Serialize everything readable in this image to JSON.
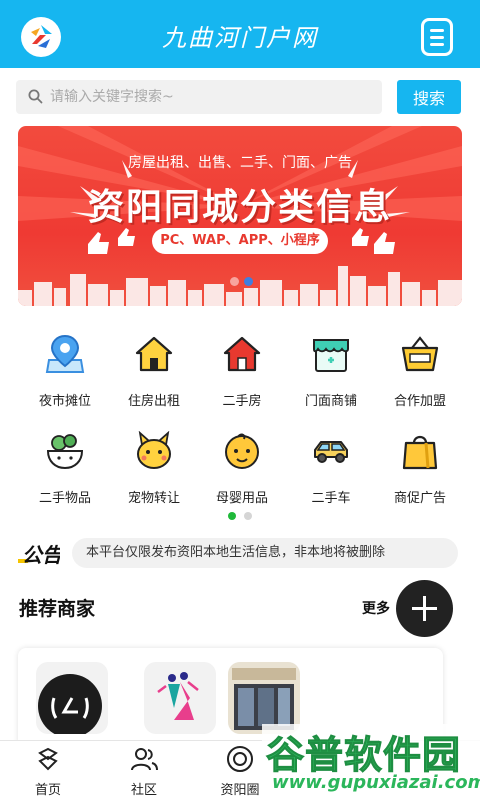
{
  "header": {
    "title": "九曲河门户网"
  },
  "search": {
    "placeholder": "请输入关键字搜索~",
    "button_label": "搜索"
  },
  "banner": {
    "subtitle": "房屋出租、出售、二手、门面、广告",
    "title": "资阳同城分类信息",
    "pill": "PC、WAP、APP、小程序",
    "slide_count": 2,
    "active_slide": 1
  },
  "categories": [
    {
      "label": "夜市摊位",
      "icon": "map-pin-icon"
    },
    {
      "label": "住房出租",
      "icon": "house-icon"
    },
    {
      "label": "二手房",
      "icon": "red-house-icon"
    },
    {
      "label": "门面商铺",
      "icon": "storefront-icon"
    },
    {
      "label": "合作加盟",
      "icon": "basket-icon"
    },
    {
      "label": "二手物品",
      "icon": "vegetable-bowl-icon"
    },
    {
      "label": "宠物转让",
      "icon": "pet-icon"
    },
    {
      "label": "母婴用品",
      "icon": "baby-icon"
    },
    {
      "label": "二手车",
      "icon": "car-icon"
    },
    {
      "label": "商促广告",
      "icon": "shopping-bag-icon"
    }
  ],
  "grid_pages": {
    "count": 2,
    "active": 0
  },
  "notice": {
    "label": "公告",
    "text": "本平台仅限发布资阳本地生活信息，非本地将被删除"
  },
  "recommend": {
    "title": "推荐商家",
    "more_label": "更多"
  },
  "bottom_nav": [
    {
      "label": "首页",
      "icon": "home-icon"
    },
    {
      "label": "社区",
      "icon": "community-icon"
    },
    {
      "label": "资阳圈",
      "icon": "circle-icon"
    }
  ],
  "watermark": {
    "main": "谷普软件园",
    "url": "www.gupuxiazai.com"
  },
  "colors": {
    "brand": "#16b6f0",
    "banner_red": "#ef3a33",
    "active_dot": "#1fb93a"
  }
}
